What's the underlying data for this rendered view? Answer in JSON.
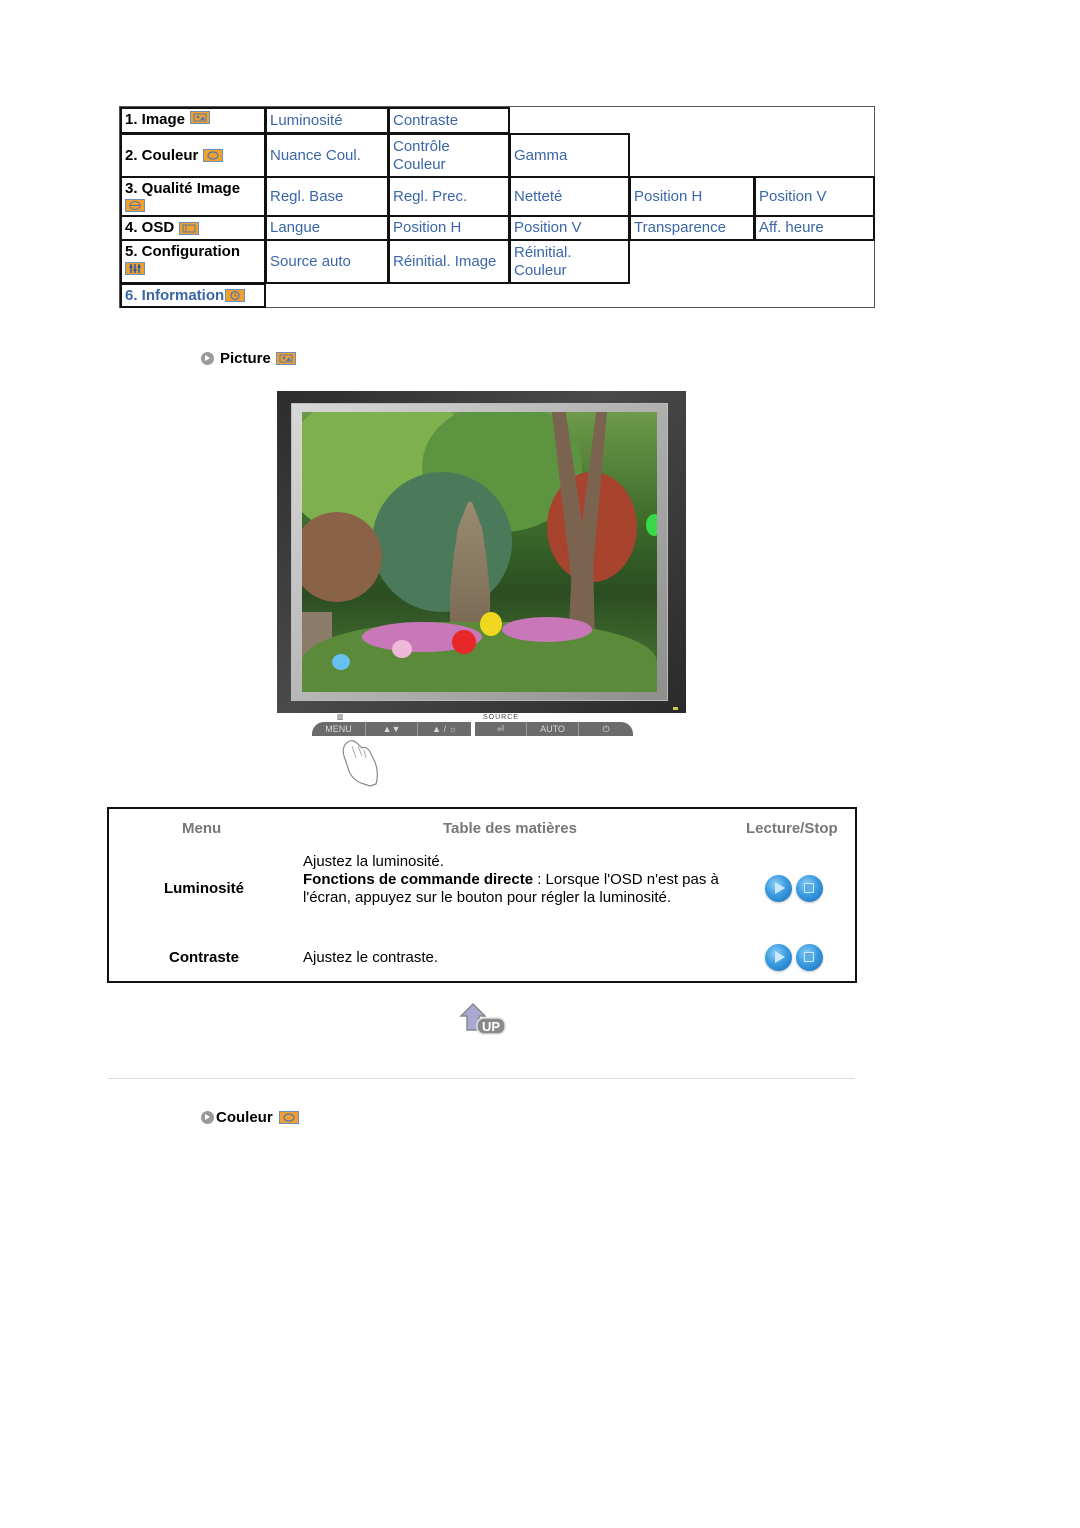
{
  "nav": {
    "rows": [
      {
        "header": "1. Image",
        "icon": "image-icon",
        "items": [
          "Luminosité",
          "Contraste"
        ]
      },
      {
        "header": "2. Couleur",
        "icon": "color-icon",
        "items": [
          "Nuance Coul.",
          "Contrôle Couleur",
          "Gamma"
        ]
      },
      {
        "header": "3. Qualité Image",
        "icon": "image-quality-icon",
        "items": [
          "Regl. Base",
          "Regl. Prec.",
          "Netteté",
          "Position H",
          "Position V"
        ]
      },
      {
        "header": "4. OSD",
        "icon": "osd-icon",
        "items": [
          "Langue",
          "Position H",
          "Position V",
          "Transparence",
          "Aff. heure"
        ]
      },
      {
        "header": "5. Configuration",
        "icon": "setup-icon",
        "items": [
          "Source auto",
          "Réinitial. Image",
          "Réinitial. Couleur"
        ]
      },
      {
        "header": "6. Information",
        "icon": "information-icon",
        "items": []
      }
    ]
  },
  "section_picture": {
    "title": "Picture",
    "icon": "image-icon"
  },
  "monitor": {
    "controls": [
      "MENU",
      "▲▼",
      "▲ / ☼",
      "⏎",
      "AUTO",
      "⏻"
    ],
    "labels": {
      "menu_top": "▥",
      "source_top": "SOURCE"
    }
  },
  "functions": {
    "headers": {
      "menu": "Menu",
      "contents": "Table des matières",
      "play": "Lecture/Stop"
    },
    "rows": [
      {
        "name": "Luminosité",
        "line1": "Ajustez la luminosité.",
        "bold": "Fonctions de commande directe",
        "rest": " : Lorsque l'OSD n'est pas à l'écran, appuyez sur le bouton pour régler la luminosité."
      },
      {
        "name": "Contraste",
        "line1": "Ajustez le contraste."
      }
    ]
  },
  "up_label": "UP",
  "section_couleur": {
    "title": "Couleur",
    "icon": "color-icon"
  }
}
